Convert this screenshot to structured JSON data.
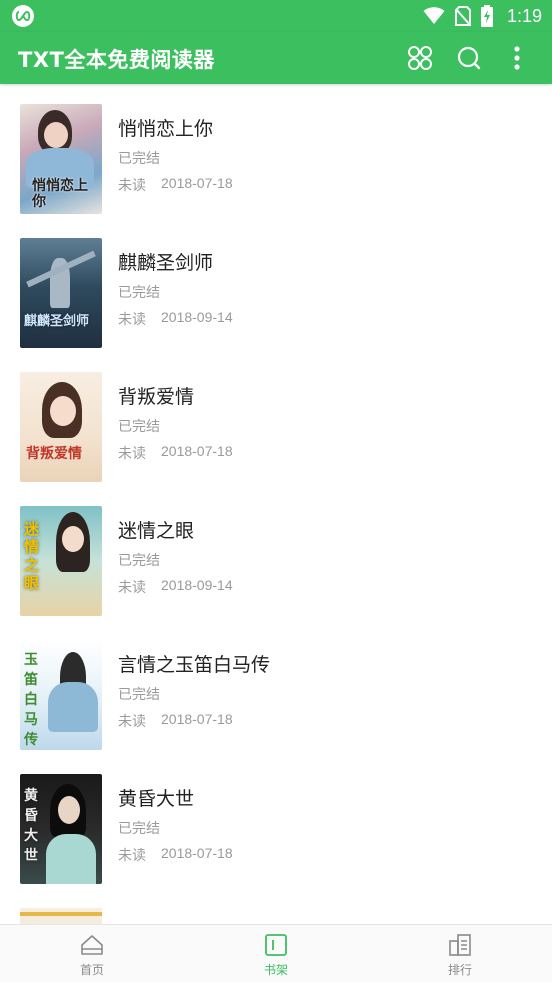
{
  "status_bar": {
    "time": "1:19"
  },
  "app_bar": {
    "title": "TXT全本免费阅读器",
    "actions": [
      {
        "icon": "apps-grid-icon"
      },
      {
        "icon": "search-icon"
      },
      {
        "icon": "more-vert-icon"
      }
    ]
  },
  "books": [
    {
      "title": "悄悄恋上你",
      "status": "已完结",
      "read_state": "未读",
      "date": "2018-07-18",
      "cover_text": "悄悄恋上你"
    },
    {
      "title": "麒麟圣剑师",
      "status": "已完结",
      "read_state": "未读",
      "date": "2018-09-14",
      "cover_text": "麒麟圣剑师"
    },
    {
      "title": "背叛爱情",
      "status": "已完结",
      "read_state": "未读",
      "date": "2018-07-18",
      "cover_text": "背叛爱情"
    },
    {
      "title": "迷情之眼",
      "status": "已完结",
      "read_state": "未读",
      "date": "2018-09-14",
      "cover_text": "迷情之眼"
    },
    {
      "title": "言情之玉笛白马传",
      "status": "已完结",
      "read_state": "未读",
      "date": "2018-07-18",
      "cover_text": "玉笛白马传"
    },
    {
      "title": "黄昏大世",
      "status": "已完结",
      "read_state": "未读",
      "date": "2018-07-18",
      "cover_text": "黄昏大世"
    }
  ],
  "bottom_nav": [
    {
      "label": "首页",
      "icon": "home-icon",
      "active": false
    },
    {
      "label": "书架",
      "icon": "bookshelf-icon",
      "active": true
    },
    {
      "label": "排行",
      "icon": "ranking-icon",
      "active": false
    }
  ],
  "colors": {
    "primary": "#3bbf5f",
    "text": "#222222",
    "secondary_text": "#9a9a9a"
  }
}
